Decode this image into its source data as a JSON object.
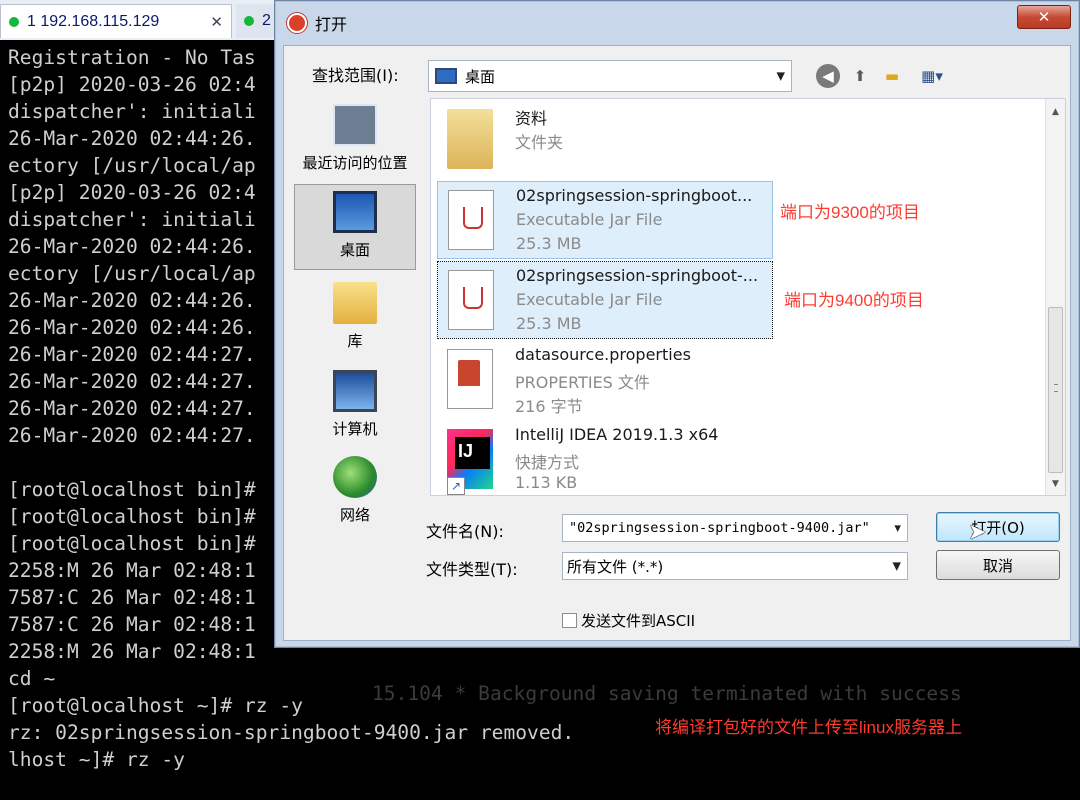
{
  "terminal": {
    "tabs": [
      {
        "label": "1 192.168.115.129",
        "close": "✕",
        "status_color": "#12b83a"
      },
      {
        "label": "2",
        "status_color": "#12b83a"
      }
    ],
    "lines": [
      "Registration - No Tas",
      "[p2p] 2020-03-26 02:4",
      "dispatcher': initiali",
      "26-Mar-2020 02:44:26.",
      "ectory [/usr/local/ap",
      "[p2p] 2020-03-26 02:4",
      "dispatcher': initiali",
      "26-Mar-2020 02:44:26.",
      "ectory [/usr/local/ap",
      "26-Mar-2020 02:44:26.",
      "26-Mar-2020 02:44:26.",
      "26-Mar-2020 02:44:27.",
      "26-Mar-2020 02:44:27.",
      "26-Mar-2020 02:44:27.",
      "26-Mar-2020 02:44:27.",
      "",
      "[root@localhost bin]#",
      "[root@localhost bin]#",
      "[root@localhost bin]#",
      "2258:M 26 Mar 02:48:1",
      "7587:C 26 Mar 02:48:1",
      "7587:C 26 Mar 02:48:1",
      "2258:M 26 Mar 02:48:1",
      "cd ~",
      "[root@localhost ~]# rz -y",
      "rz: 02springsession-springboot-9400.jar removed.",
      "lhost ~]# rz -y"
    ],
    "ghost_text": "15.104 * Background saving terminated with success"
  },
  "annotations": {
    "port_9300": "端口为9300的项目",
    "port_9400": "端口为9400的项目",
    "upload_note": "将编译打包好的文件上传至linux服务器上"
  },
  "dialog": {
    "title": "打开",
    "close_label": "✕",
    "lookin_label": "查找范围(I):",
    "lookin_value": "桌面",
    "places": [
      {
        "label": "最近访问的位置",
        "icon": "recent-places-icon"
      },
      {
        "label": "桌面",
        "icon": "desktop-icon"
      },
      {
        "label": "库",
        "icon": "library-icon"
      },
      {
        "label": "计算机",
        "icon": "computer-icon"
      },
      {
        "label": "网络",
        "icon": "network-icon"
      }
    ],
    "files": [
      {
        "name": "资料",
        "type": "文件夹",
        "size": "",
        "icon": "folder-icon"
      },
      {
        "name": "02springsession-springboot...",
        "type": "Executable Jar File",
        "size": "25.3 MB",
        "icon": "jar-file-icon"
      },
      {
        "name": "02springsession-springboot-...",
        "type": "Executable Jar File",
        "size": "25.3 MB",
        "icon": "jar-file-icon"
      },
      {
        "name": "datasource.properties",
        "type": "PROPERTIES 文件",
        "size": "216 字节",
        "icon": "properties-file-icon"
      },
      {
        "name": "IntelliJ IDEA 2019.1.3 x64",
        "type": "快捷方式",
        "size": "1.13 KB",
        "icon": "intellij-idea-icon"
      }
    ],
    "filename_label": "文件名(N):",
    "filename_value": "\"02springsession-springboot-9400.jar\"",
    "filetype_label": "文件类型(T):",
    "filetype_value": "所有文件 (*.*)",
    "open_label": "打开(O)",
    "cancel_label": "取消",
    "ascii_label": "发送文件到ASCII"
  }
}
